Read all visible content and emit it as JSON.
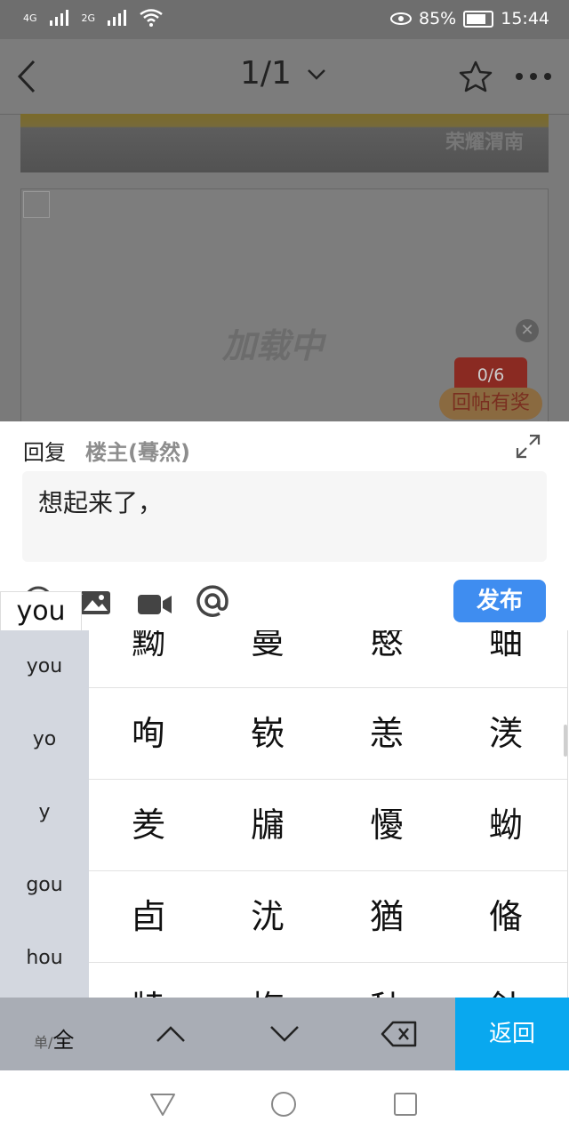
{
  "status_bar": {
    "net1": "4G",
    "net2": "2G",
    "battery_pct": "85%",
    "time": "15:44"
  },
  "nav": {
    "page_indicator": "1/1"
  },
  "content": {
    "banner_brand": "荣耀渭南",
    "loading_text": "加载中",
    "reply_counter": "0/6",
    "reward_button": "回帖有奖"
  },
  "reply": {
    "label": "回复",
    "target": "楼主(蓦然)",
    "text": "想起来了，",
    "publish_label": "发布"
  },
  "ime": {
    "composing": "you",
    "pinyin": [
      "you",
      "yo",
      "y",
      "gou",
      "hou"
    ],
    "candidates": [
      [
        "黝",
        "曼",
        "愍",
        "蚰"
      ],
      [
        "咰",
        "嵚",
        "恙",
        "湵"
      ],
      [
        "羑",
        "牖",
        "懮",
        "蚴"
      ],
      [
        "卣",
        "沋",
        "猶",
        "偹"
      ],
      [
        "牍",
        "梅",
        "秈",
        "釷"
      ]
    ],
    "toggle_single": "单/",
    "toggle_full": "全",
    "return_label": "返回"
  },
  "colors": {
    "publish": "#3f8df0",
    "ime_return": "#09a8ef",
    "pinyin_bg": "#d3d7df"
  }
}
